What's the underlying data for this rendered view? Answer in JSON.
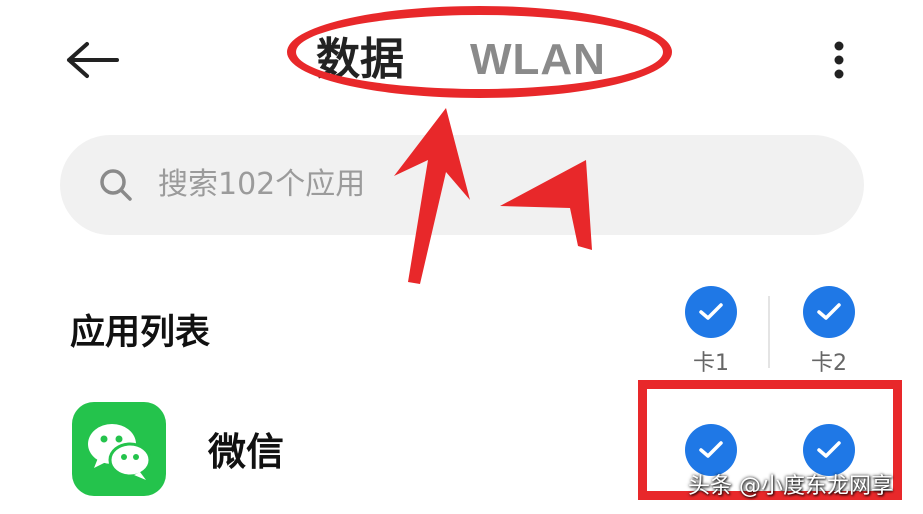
{
  "header": {
    "tabs": [
      {
        "label": "数据",
        "active": true
      },
      {
        "label": "WLAN",
        "active": false
      }
    ],
    "back_icon": "back-arrow-icon",
    "more_icon": "more-vertical-icon"
  },
  "search": {
    "placeholder": "搜索102个应用",
    "icon": "search-icon"
  },
  "section": {
    "title": "应用列表"
  },
  "columns": [
    {
      "label": "卡1",
      "checked": true
    },
    {
      "label": "卡2",
      "checked": true
    }
  ],
  "apps": [
    {
      "name": "微信",
      "sim1_checked": true,
      "sim2_checked": true
    }
  ],
  "watermark": "头条 @小度东龙网享",
  "colors": {
    "accent": "#1f78e6",
    "annotation": "#e8282a",
    "wechat_green": "#24c34c",
    "search_bg": "#f1f1f1"
  }
}
